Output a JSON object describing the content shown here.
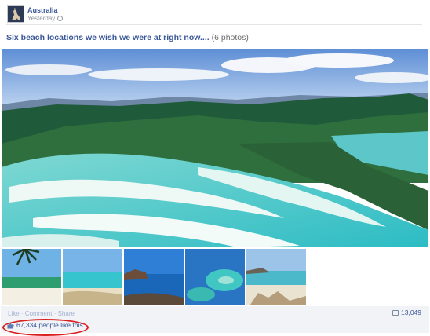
{
  "post": {
    "page_name": "Australia",
    "timestamp": "Yesterday",
    "visibility_icon": "globe-icon",
    "title": "Six beach locations we wish we were at right now....",
    "photo_count": "(6 photos)"
  },
  "hero_photo": {
    "alt": "Aerial view of white silica sand swirling through turquoise water between green hills"
  },
  "thumbnails": [
    {
      "alt": "Palm frond over beach"
    },
    {
      "alt": "Turquoise sea and sand"
    },
    {
      "alt": "Blue bay with headland"
    },
    {
      "alt": "Reef from the air"
    },
    {
      "alt": "Beach with rocky outcrop"
    }
  ],
  "footer": {
    "like_label": "Like",
    "comment_label": "Comment",
    "share_label": "Share",
    "comment_count": "13,049",
    "likes_text": "67,334 people like this"
  },
  "colors": {
    "link": "#3b5998",
    "footer_bg": "#f2f3f7",
    "highlight": "#d81e1e"
  }
}
